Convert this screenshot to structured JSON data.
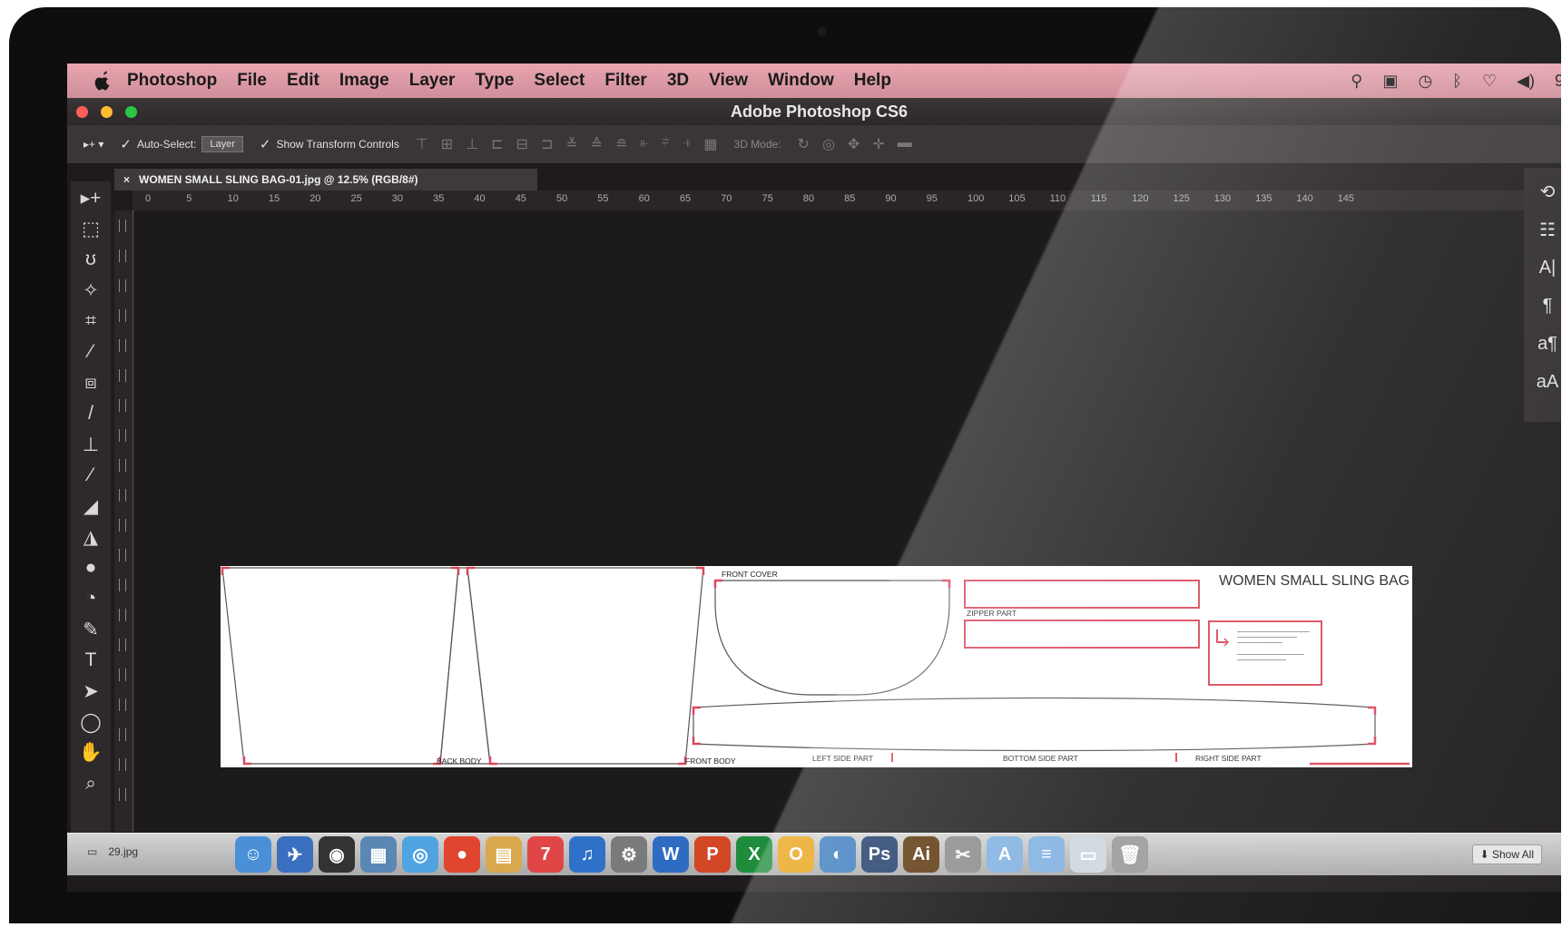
{
  "menubar": {
    "app_name": "Photoshop",
    "items": [
      "File",
      "Edit",
      "Image",
      "Layer",
      "Type",
      "Select",
      "Filter",
      "3D",
      "View",
      "Window",
      "Help"
    ],
    "status_icons": [
      "location-icon",
      "dropbox-icon",
      "time-machine-icon",
      "bluetooth-icon",
      "wifi-icon",
      "volume-icon"
    ],
    "status_trailing": "9"
  },
  "window": {
    "title": "Adobe Photoshop CS6"
  },
  "options_bar": {
    "auto_select_label": "Auto-Select:",
    "auto_select_value": "Layer",
    "show_transform_label": "Show Transform Controls",
    "mode_3d_label": "3D Mode:"
  },
  "document": {
    "tab_title": "WOMEN SMALL SLING BAG-01.jpg @ 12.5% (RGB/8#)",
    "ruler_ticks": [
      "0",
      "5",
      "10",
      "15",
      "20",
      "25",
      "30",
      "35",
      "40",
      "45",
      "50",
      "55",
      "60",
      "65",
      "70",
      "75",
      "80",
      "85",
      "90",
      "95",
      "100",
      "105",
      "110",
      "115",
      "120",
      "125",
      "130",
      "135",
      "140",
      "145"
    ],
    "pattern_title": "WOMEN  SMALL SLING BAG",
    "labels": {
      "back_body": "BACK BODY",
      "front_body": "FRONT BODY",
      "front_cover": "FRONT COVER",
      "zipper_part": "ZIPPER PART",
      "left_side_part": "LEFT SIDE PART",
      "bottom_side_part": "BOTTOM SIDE PART",
      "right_side_part": "RIGHT SIDE PART"
    }
  },
  "tools": [
    "move-tool-icon",
    "marquee-tool-icon",
    "lasso-tool-icon",
    "magic-wand-icon",
    "crop-tool-icon",
    "eyedropper-icon",
    "healing-brush-icon",
    "brush-tool-icon",
    "clone-stamp-icon",
    "history-brush-icon",
    "eraser-icon",
    "paint-bucket-icon",
    "blur-tool-icon",
    "dodge-tool-icon",
    "pen-tool-icon",
    "type-tool-icon",
    "path-selection-icon",
    "ellipse-tool-icon",
    "hand-tool-icon",
    "zoom-tool-icon"
  ],
  "tool_glyphs": [
    "▸+",
    "⬚",
    "ʊ",
    "✧",
    "⌗",
    "⁄",
    "⧈",
    "/",
    "⊥",
    "⁄",
    "◢",
    "◮",
    "●",
    "◔",
    "✎",
    "T",
    "➤",
    "◯",
    "✋",
    "⌕"
  ],
  "panel_icons": [
    "history-panel-icon",
    "properties-panel-icon",
    "character-panel-icon",
    "paragraph-panel-icon",
    "character-styles-icon",
    "paragraph-styles-icon"
  ],
  "panel_glyphs": [
    "⟲",
    "☷",
    "A|",
    "¶",
    "a¶",
    "aA"
  ],
  "dock": {
    "file_label": "29.jpg",
    "apps": [
      {
        "name": "finder-icon",
        "glyph": "☺",
        "color": "#4a90d9"
      },
      {
        "name": "launchpad-icon",
        "glyph": "✈",
        "color": "#3a6fc0"
      },
      {
        "name": "dvd-player-icon",
        "glyph": "◉",
        "color": "#333333"
      },
      {
        "name": "preview-icon",
        "glyph": "▦",
        "color": "#5b87b5"
      },
      {
        "name": "safari-icon",
        "glyph": "◎",
        "color": "#4fa3e0"
      },
      {
        "name": "chrome-icon",
        "glyph": "●",
        "color": "#e0452f"
      },
      {
        "name": "notes-icon",
        "glyph": "▤",
        "color": "#d9a84e"
      },
      {
        "name": "calendar-icon",
        "glyph": "7",
        "color": "#e04646"
      },
      {
        "name": "itunes-icon",
        "glyph": "♫",
        "color": "#2f71c9"
      },
      {
        "name": "preferences-icon",
        "glyph": "⚙",
        "color": "#7a7a7a"
      },
      {
        "name": "word-icon",
        "glyph": "W",
        "color": "#2f6cc1"
      },
      {
        "name": "powerpoint-icon",
        "glyph": "P",
        "color": "#d24726"
      },
      {
        "name": "excel-icon",
        "glyph": "X",
        "color": "#1f8c3c"
      },
      {
        "name": "outlook-icon",
        "glyph": "O",
        "color": "#e8a418"
      },
      {
        "name": "camera-icon",
        "glyph": "◐",
        "color": "#3a7bbf"
      },
      {
        "name": "photoshop-icon",
        "glyph": "Ps",
        "color": "#1d3a68"
      },
      {
        "name": "illustrator-icon",
        "glyph": "Ai",
        "color": "#5a3309"
      },
      {
        "name": "utility-icon",
        "glyph": "✂",
        "color": "#8a8a8a"
      },
      {
        "name": "applications-folder-icon",
        "glyph": "A",
        "color": "#7fb0e0"
      },
      {
        "name": "documents-folder-icon",
        "glyph": "≡",
        "color": "#7fb0e0"
      },
      {
        "name": "downloads-stack-icon",
        "glyph": "▭",
        "color": "#cfd6de"
      },
      {
        "name": "trash-icon",
        "glyph": "🗑",
        "color": "#9a9a9a"
      }
    ],
    "show_all_label": "Show All"
  },
  "colors": {
    "menubar": "#e09aa6",
    "pattern_marks": "#d9485a",
    "workspace": "#1d1a1b"
  }
}
